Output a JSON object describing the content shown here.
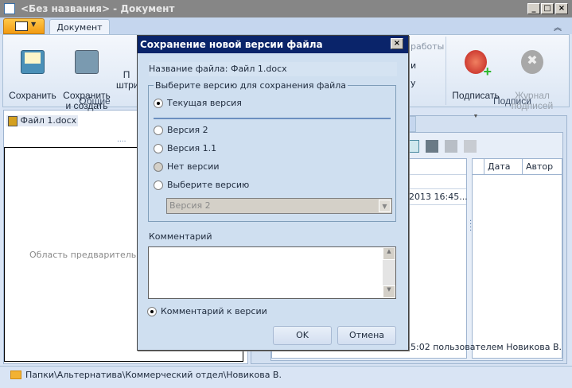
{
  "window": {
    "title": "<Без названия> - Документ",
    "minimize": "_",
    "maximize": "□",
    "close": "×"
  },
  "ribbon": {
    "tab": "Документ",
    "groups": [
      {
        "label": "Общие",
        "buttons": [
          "Сохранить",
          "Сохранить\nи создать",
          "П\nштри"
        ]
      },
      {
        "label": "Подписи",
        "buttons": [
          "Подписать",
          "Журнал\nподписей"
        ]
      }
    ],
    "hidden_items": [
      "работы",
      "и",
      "у"
    ]
  },
  "left_panel": {
    "file": "Файл 1.docx",
    "preview_text": "Область предварительного"
  },
  "right_panel": {
    "columns": [
      "Дата",
      "Автор"
    ],
    "row_text": "2013 16:45...",
    "status": "16:45:02 пользователем Новикова В."
  },
  "dialog": {
    "title": "Сохранение новой версии файла",
    "file_label": "Название файла:",
    "file_name": "Файл 1.docx",
    "group_label": "Выберите версию для сохранения файла",
    "options": [
      {
        "label": "Текущая версия",
        "selected": true,
        "enabled": true
      },
      {
        "label": "Версия 2",
        "selected": false,
        "enabled": true
      },
      {
        "label": "Версия 1.1",
        "selected": false,
        "enabled": true
      },
      {
        "label": "Нет версии",
        "selected": false,
        "enabled": false
      },
      {
        "label": "Выберите версию",
        "selected": false,
        "enabled": true
      }
    ],
    "select_value": "Версия 2",
    "comment_label": "Комментарий",
    "comment_value": "",
    "comment_option": "Комментарий к версии",
    "ok": "OK",
    "cancel": "Отмена"
  },
  "statusbar": {
    "path": "Папки\\Альтернатива\\Коммерческий отдел\\Новикова В."
  }
}
